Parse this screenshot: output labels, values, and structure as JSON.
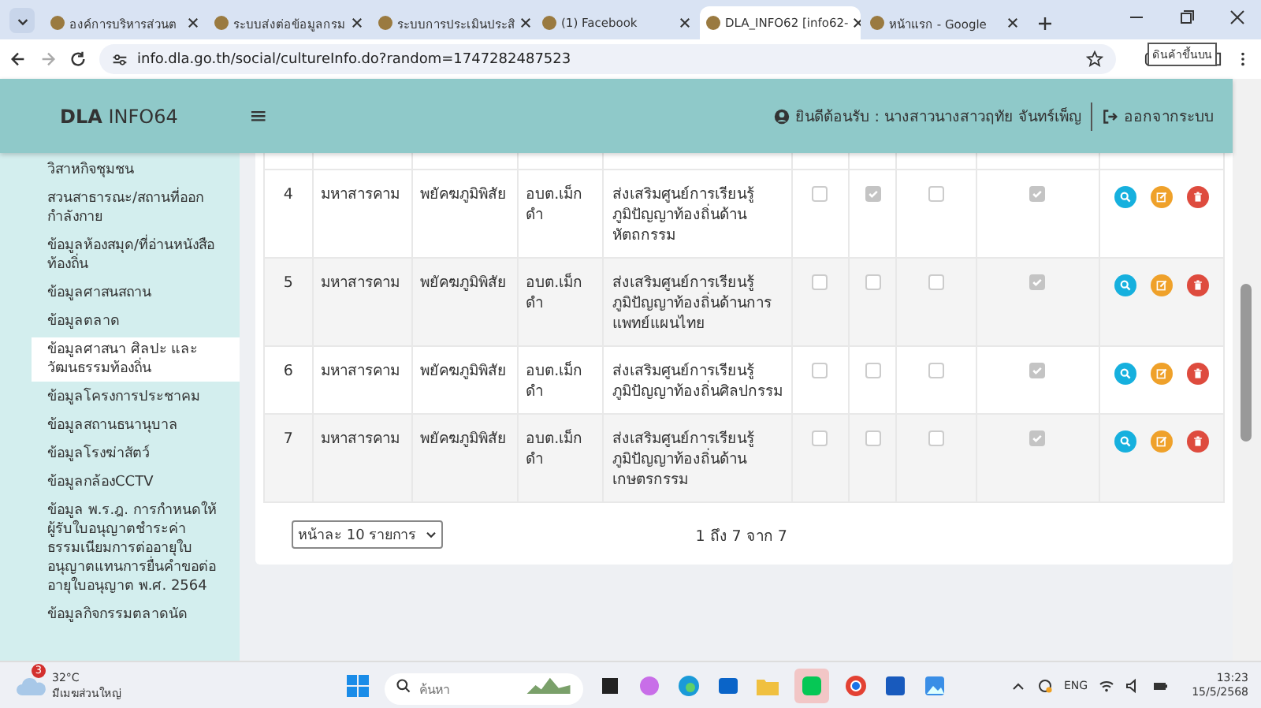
{
  "browser": {
    "tabs": [
      {
        "title": "องค์การบริหารส่วนต",
        "selected": false
      },
      {
        "title": "ระบบส่งต่อข้อมูลกรม",
        "selected": false
      },
      {
        "title": "ระบบการประเมินประสิ",
        "selected": false
      },
      {
        "title": "(1) Facebook",
        "selected": false
      },
      {
        "title": "DLA_INFO62 [info62-",
        "selected": true
      },
      {
        "title": "หน้าแรก - Google",
        "selected": false
      }
    ],
    "url": "info.dla.go.th/social/cultureInfo.do?random=1747282487523",
    "tooltip": "ดินค้าขึ้นบน"
  },
  "header": {
    "logo_bold": "DLA",
    "logo_rest": "INFO64",
    "menu_glyph": "≡",
    "welcome": "ยินดีต้อนรับ : นางสาวนางสาวฤทัย จันทร์เพ็ญ",
    "logout": "ออกจากระบบ"
  },
  "sidebar": {
    "items": [
      {
        "label": "วิสาหกิจชุมชน",
        "selected": false
      },
      {
        "label": "สวนสาธารณะ/สถานที่ออกกำลังกาย",
        "selected": false
      },
      {
        "label": "ข้อมูลห้องสมุด/ที่อ่านหนังสือท้องถิ่น",
        "selected": false
      },
      {
        "label": "ข้อมูลศาสนสถาน",
        "selected": false
      },
      {
        "label": "ข้อมูลตลาด",
        "selected": false
      },
      {
        "label": "ข้อมูลศาสนา ศิลปะ และวัฒนธรรมท้องถิ่น",
        "selected": true
      },
      {
        "label": "ข้อมูลโครงการประชาคม",
        "selected": false
      },
      {
        "label": "ข้อมูลสถานธนานุบาล",
        "selected": false
      },
      {
        "label": "ข้อมูลโรงฆ่าสัตว์",
        "selected": false
      },
      {
        "label": "ข้อมูลกล้องCCTV",
        "selected": false
      },
      {
        "label": "ข้อมูล พ.ร.ฎ. การกำหนดให้ผู้รับใบอนุญาตชำระค่าธรรมเนียมการต่ออายุใบอนุญาตแทนการยื่นคำขอต่ออายุใบอนุญาต พ.ศ. 2564",
        "selected": false
      },
      {
        "label": "ข้อมูลกิจกรรมตลาดนัด",
        "selected": false
      }
    ]
  },
  "table": {
    "rows": [
      {
        "no": "4",
        "province": "มหาสารคาม",
        "district": "พยัคฆภูมิพิสัย",
        "org": "อบต.เม็กดำ",
        "project": "ส่งเสริมศูนย์การเรียนรู้ภูมิปัญญาท้องถิ่นด้านหัตถกรรม",
        "checks": [
          false,
          true,
          false,
          true
        ]
      },
      {
        "no": "5",
        "province": "มหาสารคาม",
        "district": "พยัคฆภูมิพิสัย",
        "org": "อบต.เม็กดำ",
        "project": "ส่งเสริมศูนย์การเรียนรู้ภูมิปัญญาท้องถิ่นด้านการแพทย์แผนไทย",
        "checks": [
          false,
          false,
          false,
          true
        ]
      },
      {
        "no": "6",
        "province": "มหาสารคาม",
        "district": "พยัคฆภูมิพิสัย",
        "org": "อบต.เม็กดำ",
        "project": "ส่งเสริมศูนย์การเรียนรู้ภูมิปัญญาท้องถิ่นศิลปกรรม",
        "checks": [
          false,
          false,
          false,
          true
        ]
      },
      {
        "no": "7",
        "province": "มหาสารคาม",
        "district": "พยัคฆภูมิพิสัย",
        "org": "อบต.เม็กดำ",
        "project": "ส่งเสริมศูนย์การเรียนรู้ภูมิปัญญาท้องถิ่นด้านเกษตรกรรม",
        "checks": [
          false,
          false,
          false,
          true
        ]
      }
    ],
    "page_size": "หน้าละ 10 รายการ",
    "summary": "1 ถึง 7 จาก 7"
  },
  "taskbar": {
    "temperature": "32°C",
    "weather": "มีเมฆส่วนใหญ่",
    "badge": "3",
    "search_placeholder": "ค้นหา",
    "language": "ENG",
    "time": "13:23",
    "date": "15/5/2568"
  }
}
